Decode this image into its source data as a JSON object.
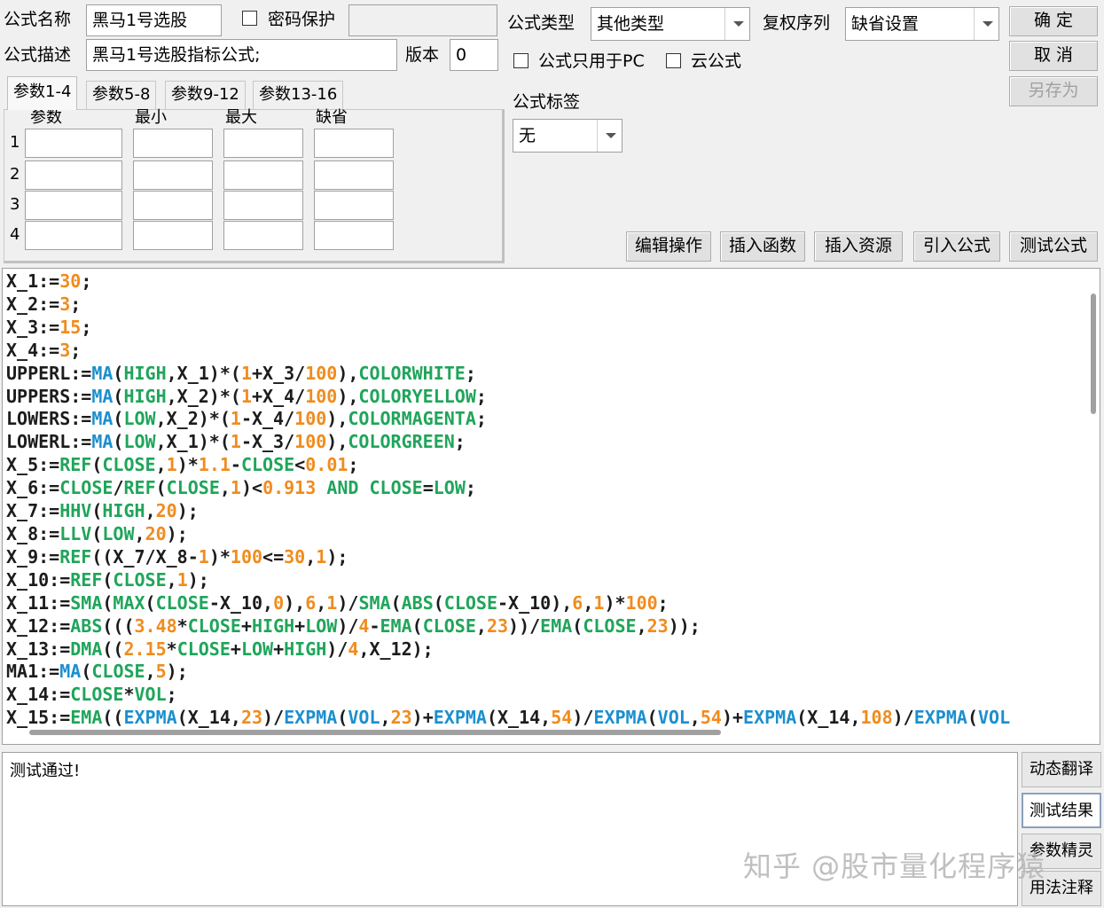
{
  "form": {
    "name_label": "公式名称",
    "name_value": "黑马1号选股",
    "password_label": "密码保护",
    "password_value": "",
    "desc_label": "公式描述",
    "desc_value": "黑马1号选股指标公式;",
    "version_label": "版本",
    "version_value": "0",
    "type_label": "公式类型",
    "type_value": "其他类型",
    "rights_label": "复权序列",
    "rights_value": "缺省设置",
    "pc_only_label": "公式只用于PC",
    "cloud_label": "云公式",
    "tag_label": "公式标签",
    "tag_value": "无"
  },
  "buttons": {
    "ok": "确  定",
    "cancel": "取  消",
    "save_as": "另存为",
    "edit_ops": "编辑操作",
    "insert_func": "插入函数",
    "insert_res": "插入资源",
    "import_formula": "引入公式",
    "test_formula": "测试公式"
  },
  "tabs": [
    "参数1-4",
    "参数5-8",
    "参数9-12",
    "参数13-16"
  ],
  "param_headers": [
    "参数",
    "最小",
    "最大",
    "缺省"
  ],
  "param_rows": [
    "1",
    "2",
    "3",
    "4"
  ],
  "colors": {
    "keyword": "#1c1c1c",
    "function_green": "#1fa55a",
    "function_blue": "#1c8fce",
    "number": "#f08c1e"
  },
  "code_lines": [
    [
      [
        "X_1:=",
        "k"
      ],
      [
        "30",
        "n"
      ],
      [
        ";",
        "k"
      ]
    ],
    [
      [
        "X_2:=",
        "k"
      ],
      [
        "3",
        "n"
      ],
      [
        ";",
        "k"
      ]
    ],
    [
      [
        "X_3:=",
        "k"
      ],
      [
        "15",
        "n"
      ],
      [
        ";",
        "k"
      ]
    ],
    [
      [
        "X_4:=",
        "k"
      ],
      [
        "3",
        "n"
      ],
      [
        ";",
        "k"
      ]
    ],
    [
      [
        "UPPERL:=",
        "k"
      ],
      [
        "MA",
        "b"
      ],
      [
        "(",
        "k"
      ],
      [
        "HIGH",
        "g"
      ],
      [
        ",X_1)*(",
        "k"
      ],
      [
        "1",
        "n"
      ],
      [
        "+X_3/",
        "k"
      ],
      [
        "100",
        "n"
      ],
      [
        "),",
        "k"
      ],
      [
        "COLORWHITE",
        "g"
      ],
      [
        ";",
        "k"
      ]
    ],
    [
      [
        "UPPERS:=",
        "k"
      ],
      [
        "MA",
        "b"
      ],
      [
        "(",
        "k"
      ],
      [
        "HIGH",
        "g"
      ],
      [
        ",X_2)*(",
        "k"
      ],
      [
        "1",
        "n"
      ],
      [
        "+X_4/",
        "k"
      ],
      [
        "100",
        "n"
      ],
      [
        "),",
        "k"
      ],
      [
        "COLORYELLOW",
        "g"
      ],
      [
        ";",
        "k"
      ]
    ],
    [
      [
        "LOWERS:=",
        "k"
      ],
      [
        "MA",
        "b"
      ],
      [
        "(",
        "k"
      ],
      [
        "LOW",
        "g"
      ],
      [
        ",X_2)*(",
        "k"
      ],
      [
        "1",
        "n"
      ],
      [
        "-X_4/",
        "k"
      ],
      [
        "100",
        "n"
      ],
      [
        "),",
        "k"
      ],
      [
        "COLORMAGENTA",
        "g"
      ],
      [
        ";",
        "k"
      ]
    ],
    [
      [
        "LOWERL:=",
        "k"
      ],
      [
        "MA",
        "b"
      ],
      [
        "(",
        "k"
      ],
      [
        "LOW",
        "g"
      ],
      [
        ",X_1)*(",
        "k"
      ],
      [
        "1",
        "n"
      ],
      [
        "-X_3/",
        "k"
      ],
      [
        "100",
        "n"
      ],
      [
        "),",
        "k"
      ],
      [
        "COLORGREEN",
        "g"
      ],
      [
        ";",
        "k"
      ]
    ],
    [
      [
        "X_5:=",
        "k"
      ],
      [
        "REF",
        "g"
      ],
      [
        "(",
        "k"
      ],
      [
        "CLOSE",
        "g"
      ],
      [
        ",",
        "k"
      ],
      [
        "1",
        "n"
      ],
      [
        ")*",
        "k"
      ],
      [
        "1.1",
        "n"
      ],
      [
        "-",
        "k"
      ],
      [
        "CLOSE",
        "g"
      ],
      [
        "<",
        "k"
      ],
      [
        "0.01",
        "n"
      ],
      [
        ";",
        "k"
      ]
    ],
    [
      [
        "X_6:=",
        "k"
      ],
      [
        "CLOSE",
        "g"
      ],
      [
        "/",
        "k"
      ],
      [
        "REF",
        "g"
      ],
      [
        "(",
        "k"
      ],
      [
        "CLOSE",
        "g"
      ],
      [
        ",",
        "k"
      ],
      [
        "1",
        "n"
      ],
      [
        ")<",
        "k"
      ],
      [
        "0.913",
        "n"
      ],
      [
        " ",
        "k"
      ],
      [
        "AND",
        "g"
      ],
      [
        " ",
        "k"
      ],
      [
        "CLOSE",
        "g"
      ],
      [
        "=",
        "k"
      ],
      [
        "LOW",
        "g"
      ],
      [
        ";",
        "k"
      ]
    ],
    [
      [
        "X_7:=",
        "k"
      ],
      [
        "HHV",
        "g"
      ],
      [
        "(",
        "k"
      ],
      [
        "HIGH",
        "g"
      ],
      [
        ",",
        "k"
      ],
      [
        "20",
        "n"
      ],
      [
        ");",
        "k"
      ]
    ],
    [
      [
        "X_8:=",
        "k"
      ],
      [
        "LLV",
        "g"
      ],
      [
        "(",
        "k"
      ],
      [
        "LOW",
        "g"
      ],
      [
        ",",
        "k"
      ],
      [
        "20",
        "n"
      ],
      [
        ");",
        "k"
      ]
    ],
    [
      [
        "X_9:=",
        "k"
      ],
      [
        "REF",
        "g"
      ],
      [
        "((X_7/X_8-",
        "k"
      ],
      [
        "1",
        "n"
      ],
      [
        ")*",
        "k"
      ],
      [
        "100",
        "n"
      ],
      [
        "<=",
        "k"
      ],
      [
        "30",
        "n"
      ],
      [
        ",",
        "k"
      ],
      [
        "1",
        "n"
      ],
      [
        ");",
        "k"
      ]
    ],
    [
      [
        "X_10:=",
        "k"
      ],
      [
        "REF",
        "g"
      ],
      [
        "(",
        "k"
      ],
      [
        "CLOSE",
        "g"
      ],
      [
        ",",
        "k"
      ],
      [
        "1",
        "n"
      ],
      [
        ");",
        "k"
      ]
    ],
    [
      [
        "X_11:=",
        "k"
      ],
      [
        "SMA",
        "g"
      ],
      [
        "(",
        "k"
      ],
      [
        "MAX",
        "g"
      ],
      [
        "(",
        "k"
      ],
      [
        "CLOSE",
        "g"
      ],
      [
        "-X_10,",
        "k"
      ],
      [
        "0",
        "n"
      ],
      [
        "),",
        "k"
      ],
      [
        "6",
        "n"
      ],
      [
        ",",
        "k"
      ],
      [
        "1",
        "n"
      ],
      [
        ")/",
        "k"
      ],
      [
        "SMA",
        "g"
      ],
      [
        "(",
        "k"
      ],
      [
        "ABS",
        "g"
      ],
      [
        "(",
        "k"
      ],
      [
        "CLOSE",
        "g"
      ],
      [
        "-X_10),",
        "k"
      ],
      [
        "6",
        "n"
      ],
      [
        ",",
        "k"
      ],
      [
        "1",
        "n"
      ],
      [
        ")*",
        "k"
      ],
      [
        "100",
        "n"
      ],
      [
        ";",
        "k"
      ]
    ],
    [
      [
        "X_12:=",
        "k"
      ],
      [
        "ABS",
        "g"
      ],
      [
        "(((",
        "k"
      ],
      [
        "3.48",
        "n"
      ],
      [
        "*",
        "k"
      ],
      [
        "CLOSE",
        "g"
      ],
      [
        "+",
        "k"
      ],
      [
        "HIGH",
        "g"
      ],
      [
        "+",
        "k"
      ],
      [
        "LOW",
        "g"
      ],
      [
        ")/",
        "k"
      ],
      [
        "4",
        "n"
      ],
      [
        "-",
        "k"
      ],
      [
        "EMA",
        "g"
      ],
      [
        "(",
        "k"
      ],
      [
        "CLOSE",
        "g"
      ],
      [
        ",",
        "k"
      ],
      [
        "23",
        "n"
      ],
      [
        "))/",
        "k"
      ],
      [
        "EMA",
        "g"
      ],
      [
        "(",
        "k"
      ],
      [
        "CLOSE",
        "g"
      ],
      [
        ",",
        "k"
      ],
      [
        "23",
        "n"
      ],
      [
        "));",
        "k"
      ]
    ],
    [
      [
        "X_13:=",
        "k"
      ],
      [
        "DMA",
        "g"
      ],
      [
        "((",
        "k"
      ],
      [
        "2.15",
        "n"
      ],
      [
        "*",
        "k"
      ],
      [
        "CLOSE",
        "g"
      ],
      [
        "+",
        "k"
      ],
      [
        "LOW",
        "g"
      ],
      [
        "+",
        "k"
      ],
      [
        "HIGH",
        "g"
      ],
      [
        ")/",
        "k"
      ],
      [
        "4",
        "n"
      ],
      [
        ",X_12);",
        "k"
      ]
    ],
    [
      [
        "MA1:=",
        "k"
      ],
      [
        "MA",
        "b"
      ],
      [
        "(",
        "k"
      ],
      [
        "CLOSE",
        "g"
      ],
      [
        ",",
        "k"
      ],
      [
        "5",
        "n"
      ],
      [
        ");",
        "k"
      ]
    ],
    [
      [
        "X_14:=",
        "k"
      ],
      [
        "CLOSE",
        "g"
      ],
      [
        "*",
        "k"
      ],
      [
        "VOL",
        "g"
      ],
      [
        ";",
        "k"
      ]
    ],
    [
      [
        "X_15:=",
        "k"
      ],
      [
        "EMA",
        "g"
      ],
      [
        "((",
        "k"
      ],
      [
        "EXPMA",
        "b"
      ],
      [
        "(X_14,",
        "k"
      ],
      [
        "23",
        "n"
      ],
      [
        ")/",
        "k"
      ],
      [
        "EXPMA",
        "b"
      ],
      [
        "(",
        "k"
      ],
      [
        "VOL",
        "b"
      ],
      [
        ",",
        "k"
      ],
      [
        "23",
        "n"
      ],
      [
        ")+",
        "k"
      ],
      [
        "EXPMA",
        "b"
      ],
      [
        "(X_14,",
        "k"
      ],
      [
        "54",
        "n"
      ],
      [
        ")/",
        "k"
      ],
      [
        "EXPMA",
        "b"
      ],
      [
        "(",
        "k"
      ],
      [
        "VOL",
        "b"
      ],
      [
        ",",
        "k"
      ],
      [
        "54",
        "n"
      ],
      [
        ")+",
        "k"
      ],
      [
        "EXPMA",
        "b"
      ],
      [
        "(X_14,",
        "k"
      ],
      [
        "108",
        "n"
      ],
      [
        ")/",
        "k"
      ],
      [
        "EXPMA",
        "b"
      ],
      [
        "(",
        "k"
      ],
      [
        "VOL",
        "b"
      ]
    ]
  ],
  "result_text": "测试通过!",
  "side_buttons": [
    "动态翻译",
    "测试结果",
    "参数精灵",
    "用法注释"
  ],
  "watermark": "知乎 @股市量化程序猿"
}
